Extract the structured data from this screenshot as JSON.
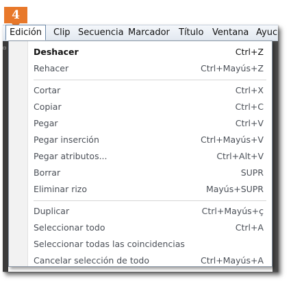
{
  "step_badge": "4",
  "menubar": {
    "items": [
      {
        "label": "Edición",
        "active": true
      },
      {
        "label": "Clip"
      },
      {
        "label": "Secuencia"
      },
      {
        "label": "Marcador"
      },
      {
        "label": "Título"
      },
      {
        "label": "Ventana"
      },
      {
        "label": "Ayuc"
      }
    ]
  },
  "menu": {
    "items": [
      {
        "label": "Deshacer",
        "shortcut": "Ctrl+Z",
        "enabled": true
      },
      {
        "label": "Rehacer",
        "shortcut": "Ctrl+Mayús+Z",
        "enabled": false
      },
      {
        "label": "Cortar",
        "shortcut": "Ctrl+X",
        "enabled": false
      },
      {
        "label": "Copiar",
        "shortcut": "Ctrl+C",
        "enabled": false
      },
      {
        "label": "Pegar",
        "shortcut": "Ctrl+V",
        "enabled": false
      },
      {
        "label": "Pegar inserción",
        "shortcut": "Ctrl+Mayús+V",
        "enabled": false
      },
      {
        "label": "Pegar atributos...",
        "shortcut": "Ctrl+Alt+V",
        "enabled": false
      },
      {
        "label": "Borrar",
        "shortcut": "SUPR",
        "enabled": false
      },
      {
        "label": "Eliminar rizo",
        "shortcut": "Mayús+SUPR",
        "enabled": false
      },
      {
        "label": "Duplicar",
        "shortcut": "Ctrl+Mayús+ç",
        "enabled": false
      },
      {
        "label": "Seleccionar todo",
        "shortcut": "Ctrl+A",
        "enabled": false
      },
      {
        "label": "Seleccionar todas las coincidencias",
        "shortcut": "",
        "enabled": false
      },
      {
        "label": "Cancelar selección de todo",
        "shortcut": "Ctrl+Mayús+A",
        "enabled": false
      }
    ]
  },
  "colors": {
    "badge": "#e8782a",
    "enabled_text": "#111111",
    "disabled_text": "#4a4f57"
  }
}
